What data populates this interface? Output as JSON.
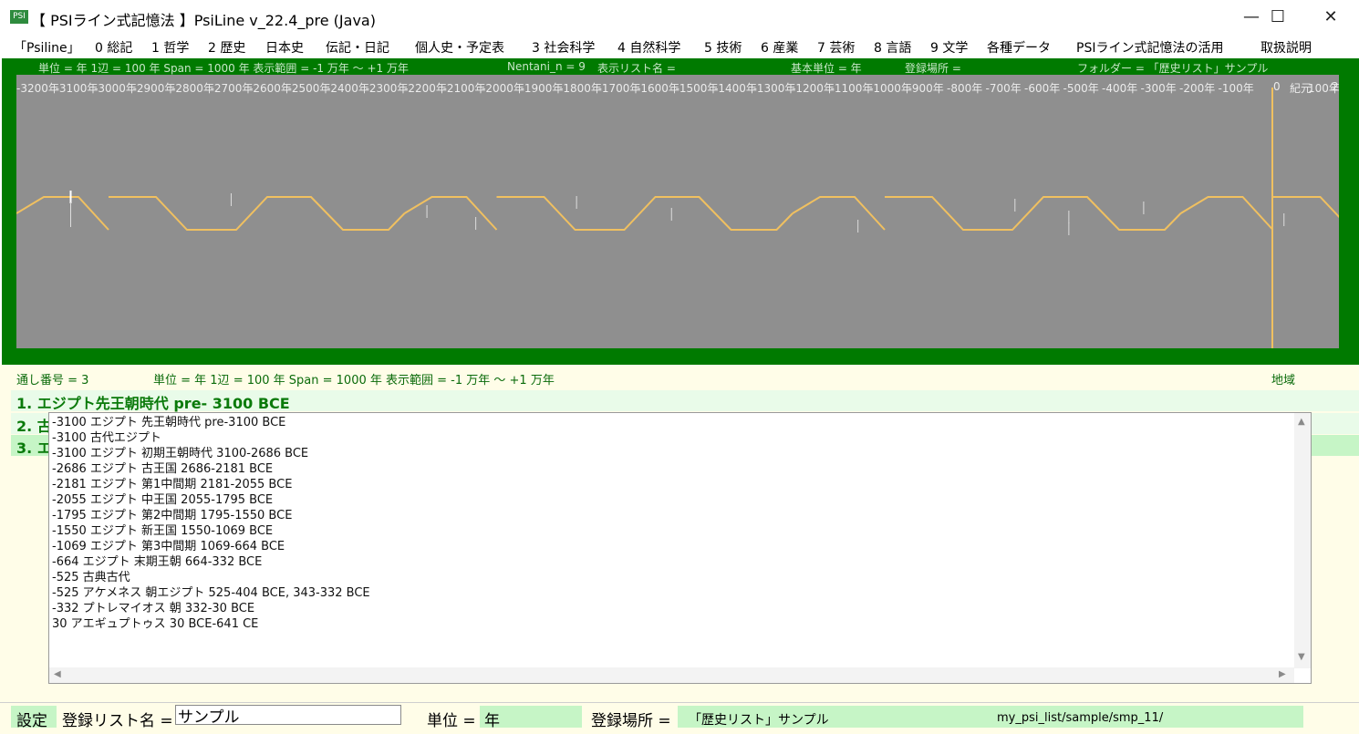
{
  "window": {
    "icon_text": "PSI",
    "title": "【 PSIライン式記憶法 】PsiLine v_22.4_pre (Java)",
    "minimize_glyph": "—",
    "maximize_glyph": "☐",
    "close_glyph": "✕"
  },
  "menu": [
    "「Psiline」",
    "0 総記",
    "1 哲学",
    "2 歴史",
    "日本史",
    "伝記・日記",
    "個人史・予定表",
    "3 社会科学",
    "4 自然科学",
    "5 技術",
    "6 産業",
    "7 芸術",
    "8 言語",
    "9 文学",
    "各種データ",
    "PSIライン式記憶法の活用",
    "取扱説明"
  ],
  "top_info": {
    "unit_span": "単位 = 年  1辺 = 100 年  Span = 1000 年  表示範囲 = -1 万年 ～ +1 万年",
    "nentani": "Nentani_n = 9",
    "list_name": "表示リスト名 =",
    "base_unit": "基本単位 = 年",
    "place": "登録場所 =",
    "folder": "フォルダー = 「歴史リスト」サンプル"
  },
  "axis_labels": [
    "-3200年",
    "-3100年",
    "-3000年",
    "-2900年",
    "-2800年",
    "-2700年",
    "-2600年",
    "-2500年",
    "-2400年",
    "-2300年",
    "-2200年",
    "-2100年",
    "-2000年",
    "-1900年",
    "-1800年",
    "-1700年",
    "-1600年",
    "-1500年",
    "-1400年",
    "-1300年",
    "-1200年",
    "-1100年",
    "-1000年",
    "-900年",
    "-800年",
    "-700年",
    "-600年",
    "-500年",
    "-400年",
    "-300年",
    "-200年",
    "-100年",
    "0",
    "紀元",
    "100年",
    "2"
  ],
  "line_color": "#f0c060",
  "events": [
    -3100,
    -3100,
    -3100,
    -2686,
    -2181,
    -2055,
    -1795,
    -1550,
    -1069,
    -664,
    -525,
    -525,
    -332,
    30
  ],
  "mid_info": {
    "serial": "通し番号 = 3",
    "unit_span": "単位 = 年  1辺 = 100 年  Span = 1000 年  表示範囲 = -1 万年 ～ +1 万年",
    "region": "地域"
  },
  "list_items": [
    "1. エジプト先王朝時代 pre- 3100 BCE",
    "2. 古",
    "3. エ"
  ],
  "textarea_lines": [
    "-3100  エジプト 先王朝時代 pre-3100 BCE",
    "-3100  古代エジプト",
    "-3100  エジプト 初期王朝時代 3100-2686 BCE",
    "-2686  エジプト 古王国 2686-2181 BCE",
    "-2181  エジプト 第1中間期 2181-2055 BCE",
    "-2055  エジプト 中王国 2055-1795 BCE",
    "-1795  エジプト 第2中間期 1795-1550 BCE",
    "-1550  エジプト 新王国 1550-1069 BCE",
    "-1069  エジプト 第3中間期 1069-664 BCE",
    "-664  エジプト 末期王朝 664-332 BCE",
    "-525  古典古代",
    "-525  アケメネス 朝エジプト 525-404 BCE, 343-332 BCE",
    "-332  プトレマイオス 朝 332-30 BCE",
    "30  アエギュプトゥス 30 BCE-641 CE"
  ],
  "bottom": {
    "settings": "設定",
    "reg_list_label": "登録リスト名 =",
    "reg_list_value": "サンプル",
    "unit_label": "単位 =",
    "unit_value": "年",
    "place_label": "登録場所 =",
    "place_value": "「歴史リスト」サンプル",
    "path": "my_psi_list/sample/smp_11/"
  }
}
